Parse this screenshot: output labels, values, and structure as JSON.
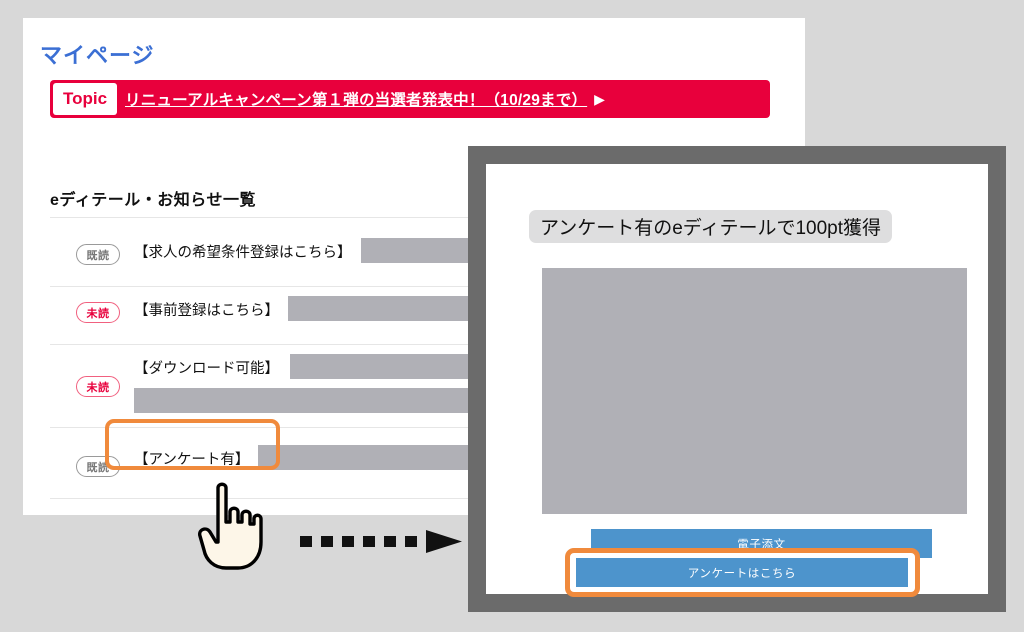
{
  "page": {
    "title": "マイページ",
    "list_heading": "eディテール・お知らせ一覧"
  },
  "topic": {
    "label": "Topic",
    "link_text": "リニューアルキャンペーン第１弾の当選者発表中！（10/29まで）",
    "arrow_icon": "play-triangle-icon"
  },
  "notices": [
    {
      "status": "既読",
      "status_type": "read",
      "text": "【求人の希望条件登録はこちら】"
    },
    {
      "status": "未読",
      "status_type": "unread",
      "text": "【事前登録はこちら】"
    },
    {
      "status": "未読",
      "status_type": "unread",
      "text": "【ダウンロード可能】"
    },
    {
      "status": "既読",
      "status_type": "read",
      "text": "【アンケート有】"
    }
  ],
  "detail_panel": {
    "title": "アンケート有のeディテールで100pt獲得",
    "buttons": [
      {
        "label": "電子添文",
        "highlighted": false
      },
      {
        "label": "アンケートはこちら",
        "highlighted": true
      }
    ]
  },
  "annotations": {
    "cursor_icon": "pointing-hand-cursor-icon",
    "flow_arrow_icon": "dotted-right-arrow-icon",
    "highlight_color": "#f08a3c"
  },
  "colors": {
    "background": "#d8d8d8",
    "topic_red": "#e8003c",
    "title_blue": "#3b6fd4",
    "button_blue": "#4d94cc",
    "panel_frame": "#6b6b6b",
    "redaction_gray": "#b0b0b6"
  }
}
